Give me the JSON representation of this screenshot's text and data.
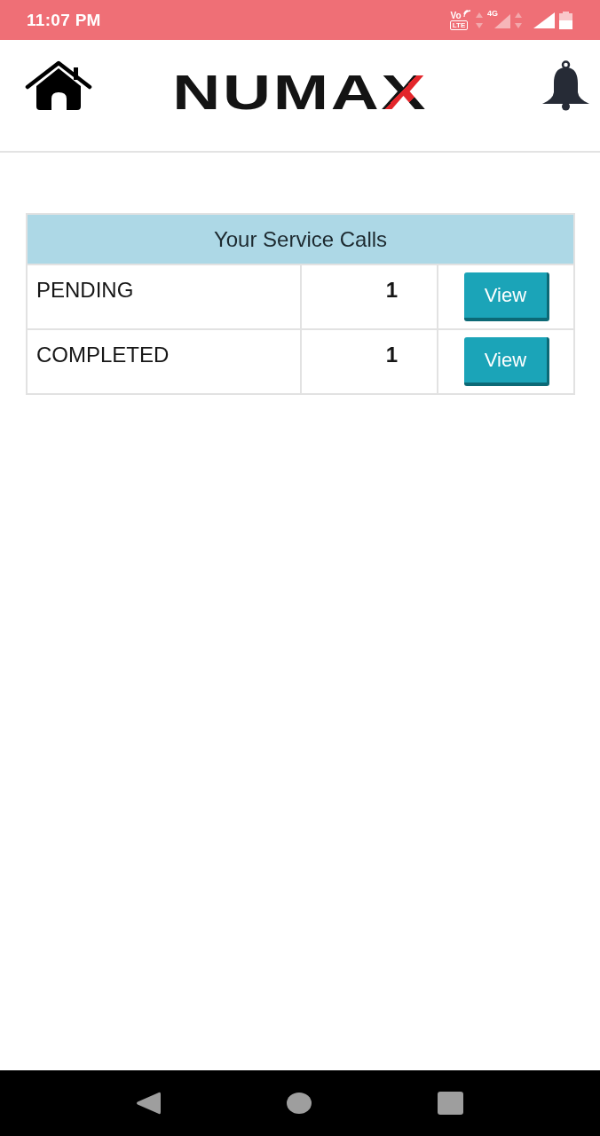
{
  "status_bar": {
    "time": "11:07 PM",
    "volte_top": "Vo",
    "volte_bottom": "LTE",
    "network_type": "4G"
  },
  "header": {
    "logo": "NUMAX"
  },
  "table": {
    "title": "Your Service Calls",
    "rows": [
      {
        "status": "PENDING",
        "count": "1",
        "action": "View"
      },
      {
        "status": "COMPLETED",
        "count": "1",
        "action": "View"
      }
    ]
  }
}
